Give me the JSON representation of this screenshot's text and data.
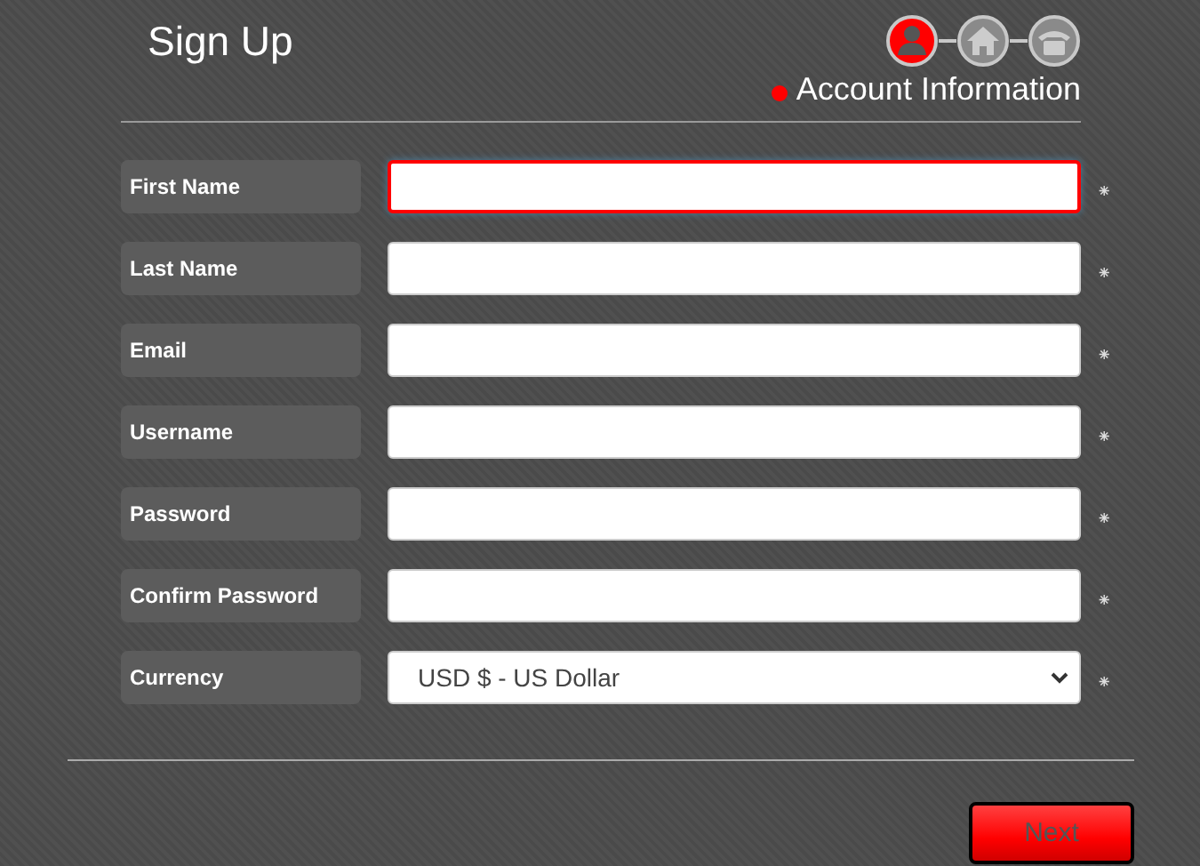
{
  "title": "Sign Up",
  "steps": [
    {
      "kind": "person",
      "selected": true
    },
    {
      "kind": "home",
      "selected": false
    },
    {
      "kind": "phone",
      "selected": false
    }
  ],
  "section": {
    "label": "Account Information",
    "color": "#ff0000"
  },
  "fields": [
    {
      "label": "First Name",
      "kind": "text",
      "focused": true,
      "required_mark": "⁕"
    },
    {
      "label": "Last Name",
      "kind": "text",
      "focused": false,
      "required_mark": "⁕"
    },
    {
      "label": "Email",
      "kind": "text",
      "focused": false,
      "required_mark": "⁕"
    },
    {
      "label": "Username",
      "kind": "text",
      "focused": false,
      "required_mark": "⁕"
    },
    {
      "label": "Password",
      "kind": "password",
      "focused": false,
      "required_mark": "⁕"
    },
    {
      "label": "Confirm Password",
      "kind": "password",
      "focused": false,
      "required_mark": "⁕"
    },
    {
      "label": "Currency",
      "kind": "select",
      "value": "USD $ - US Dollar",
      "focused": false,
      "required_mark": "⁕"
    }
  ],
  "next_button": "Next"
}
